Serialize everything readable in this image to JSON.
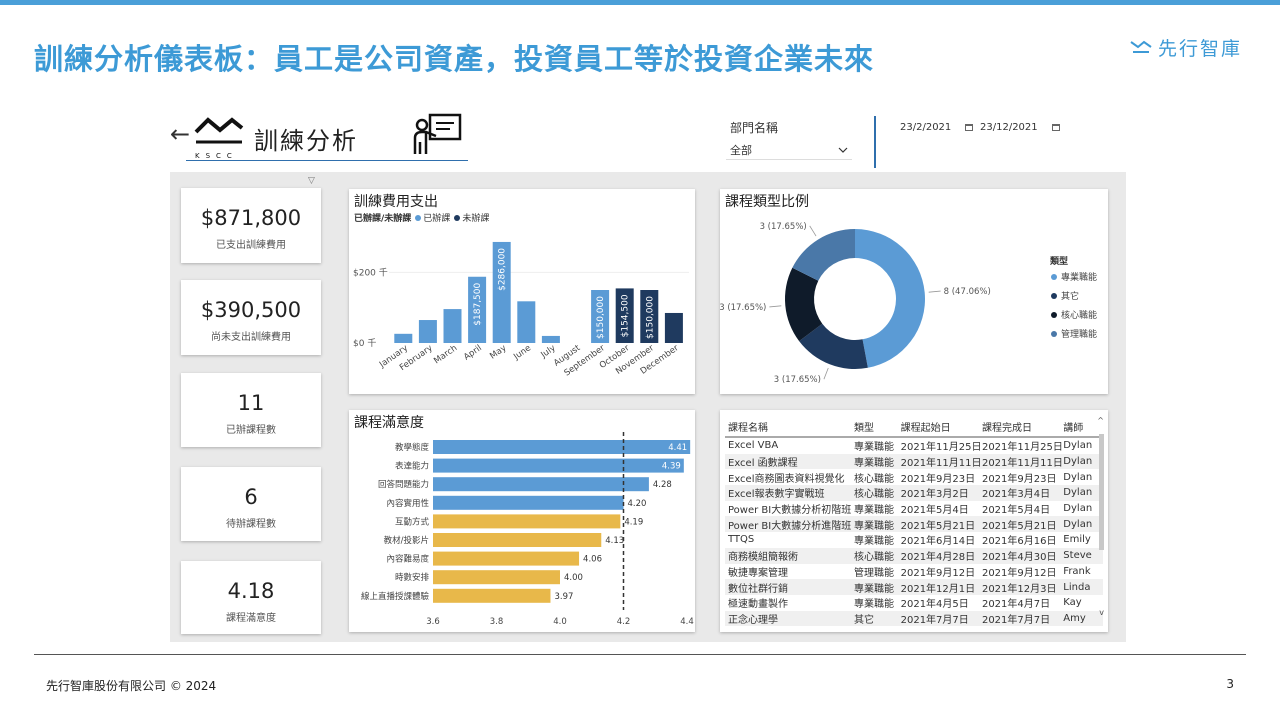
{
  "slide": {
    "title": "訓練分析儀表板：員工是公司資產，投資員工等於投資企業未來",
    "brand": "先行智庫",
    "footer_left": "先行智庫股份有限公司 © 2024",
    "page_number": "3"
  },
  "colors": {
    "accent": "#3d9ad6",
    "done": "#5b9bd5",
    "pending": "#1f3a5f",
    "gold": "#e8b84a",
    "gray": "#e9e9e9"
  },
  "dashboard": {
    "back_icon": "arrow-left-icon",
    "logo_text": "KSCC",
    "report_title": "訓練分析",
    "filter_label": "部門名稱",
    "filter_value": "全部",
    "date_start": "23/2/2021",
    "date_end": "23/12/2021"
  },
  "kpis": [
    {
      "value": "$871,800",
      "label": "已支出訓練費用"
    },
    {
      "value": "$390,500",
      "label": "尚未支出訓練費用"
    },
    {
      "value": "11",
      "label": "已辦課程數"
    },
    {
      "value": "6",
      "label": "待辦課程數"
    },
    {
      "value": "4.18",
      "label": "課程滿意度"
    }
  ],
  "panels": {
    "expense_title": "訓練費用支出",
    "expense_legend_title": "已辦課/未辦課",
    "expense_legend_done": "已辦課",
    "expense_legend_pending": "未辦課",
    "type_title": "課程類型比例",
    "type_legend_title": "類型",
    "satisfaction_title": "課程滿意度"
  },
  "chart_data": [
    {
      "type": "bar",
      "title": "訓練費用支出",
      "categories": [
        "January",
        "February",
        "March",
        "April",
        "May",
        "June",
        "July",
        "August",
        "September",
        "October",
        "November",
        "December"
      ],
      "series": [
        {
          "name": "已辦課",
          "values": [
            26000,
            65000,
            96000,
            187500,
            286000,
            118000,
            20000,
            null,
            150000,
            null,
            null,
            null
          ]
        },
        {
          "name": "未辦課",
          "values": [
            null,
            null,
            null,
            null,
            null,
            null,
            null,
            null,
            null,
            154500,
            150000,
            85000
          ]
        }
      ],
      "data_labels": {
        "3": "$187,500",
        "4": "$286,000",
        "8": "$150,000",
        "9": "$154,500",
        "10": "$150,000"
      },
      "yticks": [
        "$0 千",
        "$200 千"
      ],
      "ylim": [
        0,
        300000
      ]
    },
    {
      "type": "pie",
      "title": "課程類型比例",
      "labels": [
        "專業職能",
        "其它",
        "核心職能",
        "管理職能"
      ],
      "values": [
        8,
        3,
        3,
        3
      ],
      "slice_labels": [
        "8 (47.06%)",
        "3 (17.65%)",
        "3 (17.65%)",
        "3 (17.65%)"
      ],
      "colors": [
        "#5b9bd5",
        "#1f3a5f",
        "#0f1b2a",
        "#4a78a8"
      ]
    },
    {
      "type": "bar",
      "title": "課程滿意度",
      "categories": [
        "教學態度",
        "表達能力",
        "回答問題能力",
        "內容實用性",
        "互動方式",
        "教材/投影片",
        "內容難易度",
        "時數安排",
        "線上直播授課體驗"
      ],
      "values": [
        4.41,
        4.39,
        4.28,
        4.2,
        4.19,
        4.13,
        4.06,
        4.0,
        3.97
      ],
      "value_labels": [
        "4.41",
        "4.39",
        "4.28",
        "4.20",
        "4.19",
        "4.13",
        "4.06",
        "4.00",
        "3.97"
      ],
      "xticks": [
        "3.6",
        "3.8",
        "4.0",
        "4.2",
        "4.4"
      ],
      "xlim": [
        3.6,
        4.4
      ],
      "reference_line": 4.2
    }
  ],
  "table": {
    "headers": [
      "課程名稱",
      "類型",
      "課程起始日",
      "課程完成日",
      "講師"
    ],
    "rows": [
      [
        "Excel VBA",
        "專業職能",
        "2021年11月25日",
        "2021年11月25日",
        "Dylan"
      ],
      [
        "Excel 函數課程",
        "專業職能",
        "2021年11月11日",
        "2021年11月11日",
        "Dylan"
      ],
      [
        "Excel商務圖表資料視覺化",
        "核心職能",
        "2021年9月23日",
        "2021年9月23日",
        "Dylan"
      ],
      [
        "Excel報表數字實戰班",
        "核心職能",
        "2021年3月2日",
        "2021年3月4日",
        "Dylan"
      ],
      [
        "Power BI大數據分析初階班",
        "專業職能",
        "2021年5月4日",
        "2021年5月4日",
        "Dylan"
      ],
      [
        "Power BI大數據分析進階班",
        "專業職能",
        "2021年5月21日",
        "2021年5月21日",
        "Dylan"
      ],
      [
        "TTQS",
        "專業職能",
        "2021年6月14日",
        "2021年6月16日",
        "Emily"
      ],
      [
        "商務模組簡報術",
        "核心職能",
        "2021年4月28日",
        "2021年4月30日",
        "Steve"
      ],
      [
        "敏捷專案管理",
        "管理職能",
        "2021年9月12日",
        "2021年9月12日",
        "Frank"
      ],
      [
        "數位社群行銷",
        "專業職能",
        "2021年12月1日",
        "2021年12月3日",
        "Linda"
      ],
      [
        "極速動畫製作",
        "專業職能",
        "2021年4月5日",
        "2021年4月7日",
        "Kay"
      ],
      [
        "正念心理學",
        "其它",
        "2021年7月7日",
        "2021年7月7日",
        "Amy"
      ]
    ]
  }
}
